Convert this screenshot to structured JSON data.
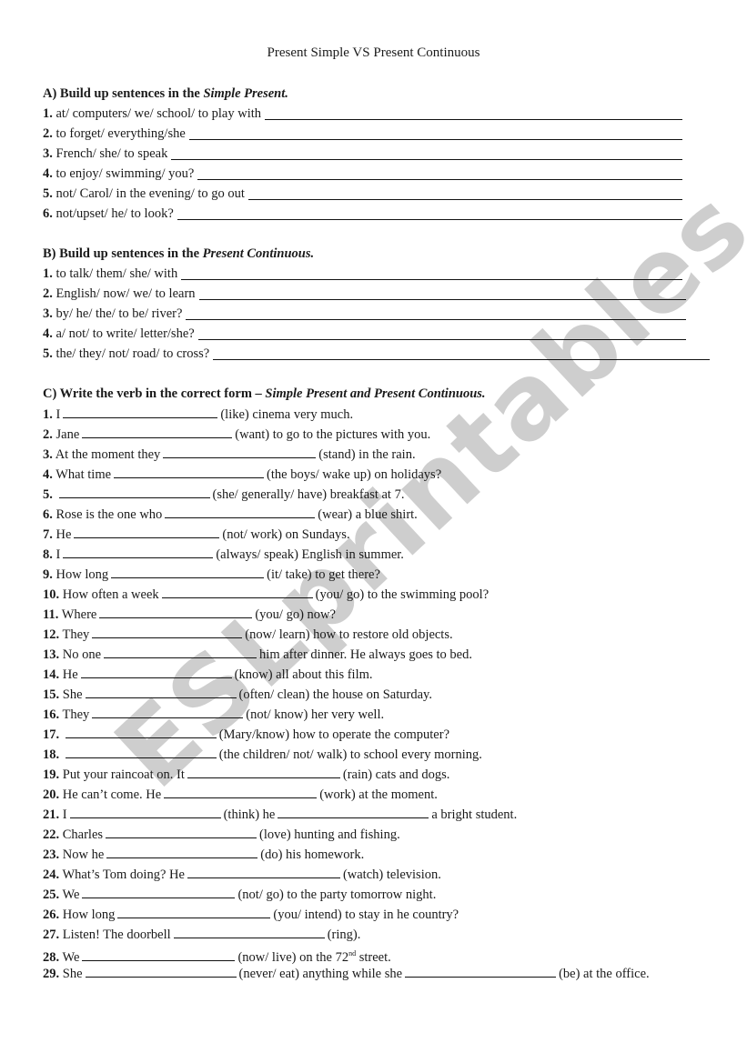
{
  "title": "Present Simple VS Present Continuous",
  "watermark": "ESLprintables.com",
  "sectionA": {
    "heading": "A) Build up sentences in the ",
    "heading_em": "Simple Present.",
    "items": [
      {
        "num": "1.",
        "text": "at/ computers/ we/ school/ to play with"
      },
      {
        "num": "2.",
        "text": "to forget/ everything/she"
      },
      {
        "num": "3.",
        "text": "French/ she/ to speak"
      },
      {
        "num": "4.",
        "text": "to enjoy/ swimming/ you?"
      },
      {
        "num": "5.",
        "text": "not/  Carol/ in the evening/ to go out"
      },
      {
        "num": "6.",
        "text": "not/upset/ he/ to look?"
      }
    ]
  },
  "sectionB": {
    "heading": "B) Build up sentences in the ",
    "heading_em": "Present Continuous.",
    "items": [
      {
        "num": "1.",
        "text": "to talk/ them/ she/ with"
      },
      {
        "num": "2.",
        "text": "English/ now/ we/ to learn"
      },
      {
        "num": "3.",
        "text": "by/ he/ the/ to be/ river?"
      },
      {
        "num": "4.",
        "text": "a/ not/ to write/ letter/she?"
      },
      {
        "num": "5.",
        "text": " the/  they/  not/  road/  to  cross?"
      }
    ]
  },
  "sectionC": {
    "heading": "C) Write the verb in the correct form – ",
    "heading_em": "Simple Present and Present Continuous.",
    "items": [
      {
        "num": "1.",
        "pre": "I",
        "post": "(like) cinema very much."
      },
      {
        "num": "2.",
        "pre": "Jane",
        "post": "(want) to go to the pictures with you."
      },
      {
        "num": "3.",
        "pre": "At the moment they",
        "post": "(stand) in the rain."
      },
      {
        "num": "4.",
        "pre": "What time",
        "post": "(the boys/ wake up) on holidays?"
      },
      {
        "num": "5.",
        "pre": "",
        "post": "(she/ generally/ have) breakfast at 7."
      },
      {
        "num": "6.",
        "pre": "Rose is the one who",
        "post": "(wear) a blue shirt."
      },
      {
        "num": "7.",
        "pre": "He",
        "post": "(not/ work) on Sundays."
      },
      {
        "num": "8.",
        "pre": "I",
        "post": "(always/ speak) English in summer."
      },
      {
        "num": "9.",
        "pre": "How long",
        "post": "(it/ take) to get there?"
      },
      {
        "num": "10.",
        "pre": "How often a week",
        "post": "(you/ go) to the swimming pool?"
      },
      {
        "num": "11.",
        "pre": "Where",
        "post": "(you/ go) now?"
      },
      {
        "num": "12.",
        "pre": "They",
        "post": "(now/ learn) how to restore old objects."
      },
      {
        "num": "13.",
        "pre": "No one",
        "post": "him after dinner. He always goes to bed."
      },
      {
        "num": "14.",
        "pre": "He",
        "post": "(know) all about this film."
      },
      {
        "num": "15.",
        "pre": "She",
        "post": "(often/ clean) the house on Saturday."
      },
      {
        "num": "16.",
        "pre": "They",
        "post": "(not/ know) her very well."
      },
      {
        "num": "17.",
        "pre": "",
        "post": "(Mary/know) how to operate the computer?"
      },
      {
        "num": "18.",
        "pre": "",
        "post": "(the children/ not/ walk) to school every morning."
      },
      {
        "num": "19.",
        "pre": "Put your raincoat on. It",
        "post": "(rain) cats and dogs."
      },
      {
        "num": "20.",
        "pre": "He can’t come. He",
        "post": "(work) at the moment."
      },
      {
        "num": "21.",
        "pre": "I",
        "mid": "(think) he",
        "post": "a bright student."
      },
      {
        "num": "22.",
        "pre": "Charles",
        "post": "(love) hunting and fishing."
      },
      {
        "num": "23.",
        "pre": "Now he",
        "post": "(do) his homework."
      },
      {
        "num": "24.",
        "pre": "What’s Tom doing? He",
        "post": "(watch) television."
      },
      {
        "num": "25.",
        "pre": "We",
        "post": "(not/ go) to the party tomorrow night."
      },
      {
        "num": "26.",
        "pre": "How long",
        "post": "(you/ intend) to stay in he country?"
      },
      {
        "num": "27.",
        "pre": "Listen! The doorbell",
        "post": "(ring)."
      },
      {
        "num": "28.",
        "pre": "We",
        "post": "(now/ live) on the 72",
        "sup": "nd",
        "post2": " street."
      },
      {
        "num": "29.",
        "pre": "She",
        "mid": "(never/ eat) anything while she",
        "post": "(be) at the",
        "cont": "office."
      }
    ]
  }
}
